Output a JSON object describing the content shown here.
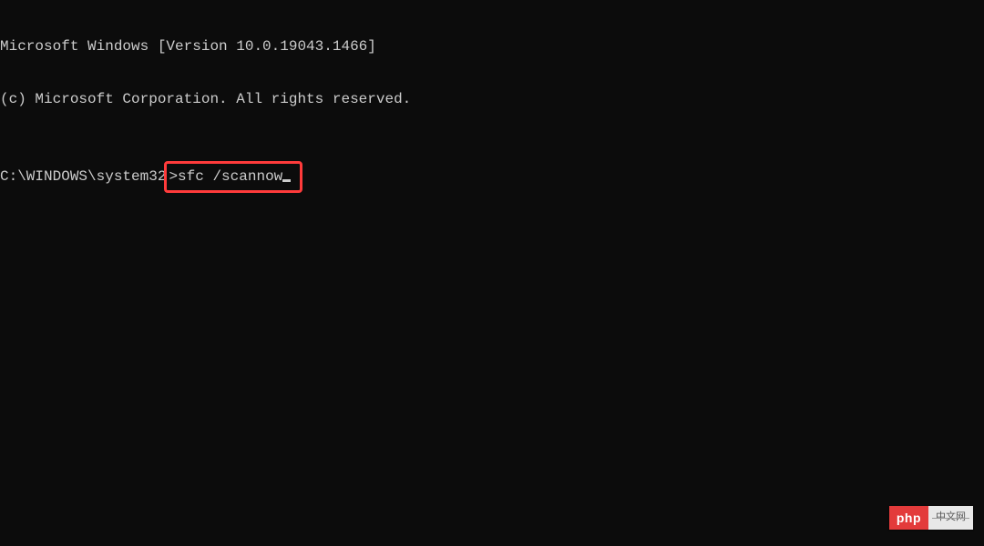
{
  "terminal": {
    "header_line1": "Microsoft Windows [Version 10.0.19043.1466]",
    "header_line2": "(c) Microsoft Corporation. All rights reserved.",
    "prompt": "C:\\WINDOWS\\system32",
    "prompt_symbol": ">",
    "command": "sfc /scannow"
  },
  "watermark": {
    "left": "php",
    "right": "中文网"
  },
  "highlight": {
    "color": "#ff3b3b"
  }
}
